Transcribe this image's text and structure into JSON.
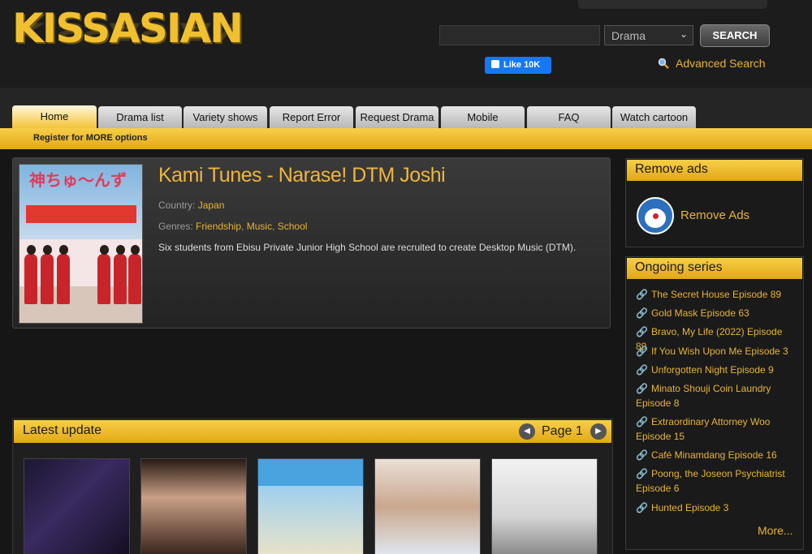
{
  "header": {
    "logo_text": "KISSASIAN",
    "search_placeholder": "",
    "search_type_selected": "Drama",
    "search_button": "SEARCH",
    "like_label": "Like 10K",
    "advanced_search": "Advanced Search"
  },
  "nav": {
    "tabs": [
      "Home",
      "Drama list",
      "Variety shows",
      "Report Error",
      "Request Drama",
      "Mobile",
      "FAQ",
      "Watch cartoon"
    ],
    "active_tab": "Home",
    "register_text": "Register for MORE options"
  },
  "show": {
    "title": "Kami Tunes - Narase! DTM Joshi",
    "country_label": "Country:",
    "country": "Japan",
    "genres_label": "Genres:",
    "genres": [
      "Friendship",
      "Music",
      "School"
    ],
    "description": "Six students from Ebisu Private Junior High School are recruited to create Desktop Music (DTM).",
    "cover_title": "神ちゅ～んず"
  },
  "latest": {
    "title": "Latest update",
    "page_label": "Page 1"
  },
  "sidebar": {
    "remove_ads_title": "Remove ads",
    "remove_ads_link": "Remove Ads",
    "ongoing_title": "Ongoing series",
    "ongoing": [
      "The Secret House Episode 89",
      "Gold Mask Episode 63",
      "Bravo, My Life (2022) Episode 89",
      "If You Wish Upon Me Episode 3",
      "Unforgotten Night Episode 9",
      "Minato Shouji Coin Laundry Episode 8",
      "Extraordinary Attorney Woo Episode 15",
      "Café Minamdang Episode 16",
      "Poong, the Joseon Psychiatrist Episode 6",
      "Hunted Episode 3"
    ],
    "more_link": "More..."
  },
  "colors": {
    "accent": "#f0b63a",
    "bar_gold": "#f2c43a",
    "background": "#161616"
  },
  "icons": [
    "search-icon",
    "like-thumb-icon",
    "chevron-down-icon",
    "paperclip-icon",
    "arrow-left-icon",
    "arrow-right-icon",
    "doraemon-icon"
  ]
}
